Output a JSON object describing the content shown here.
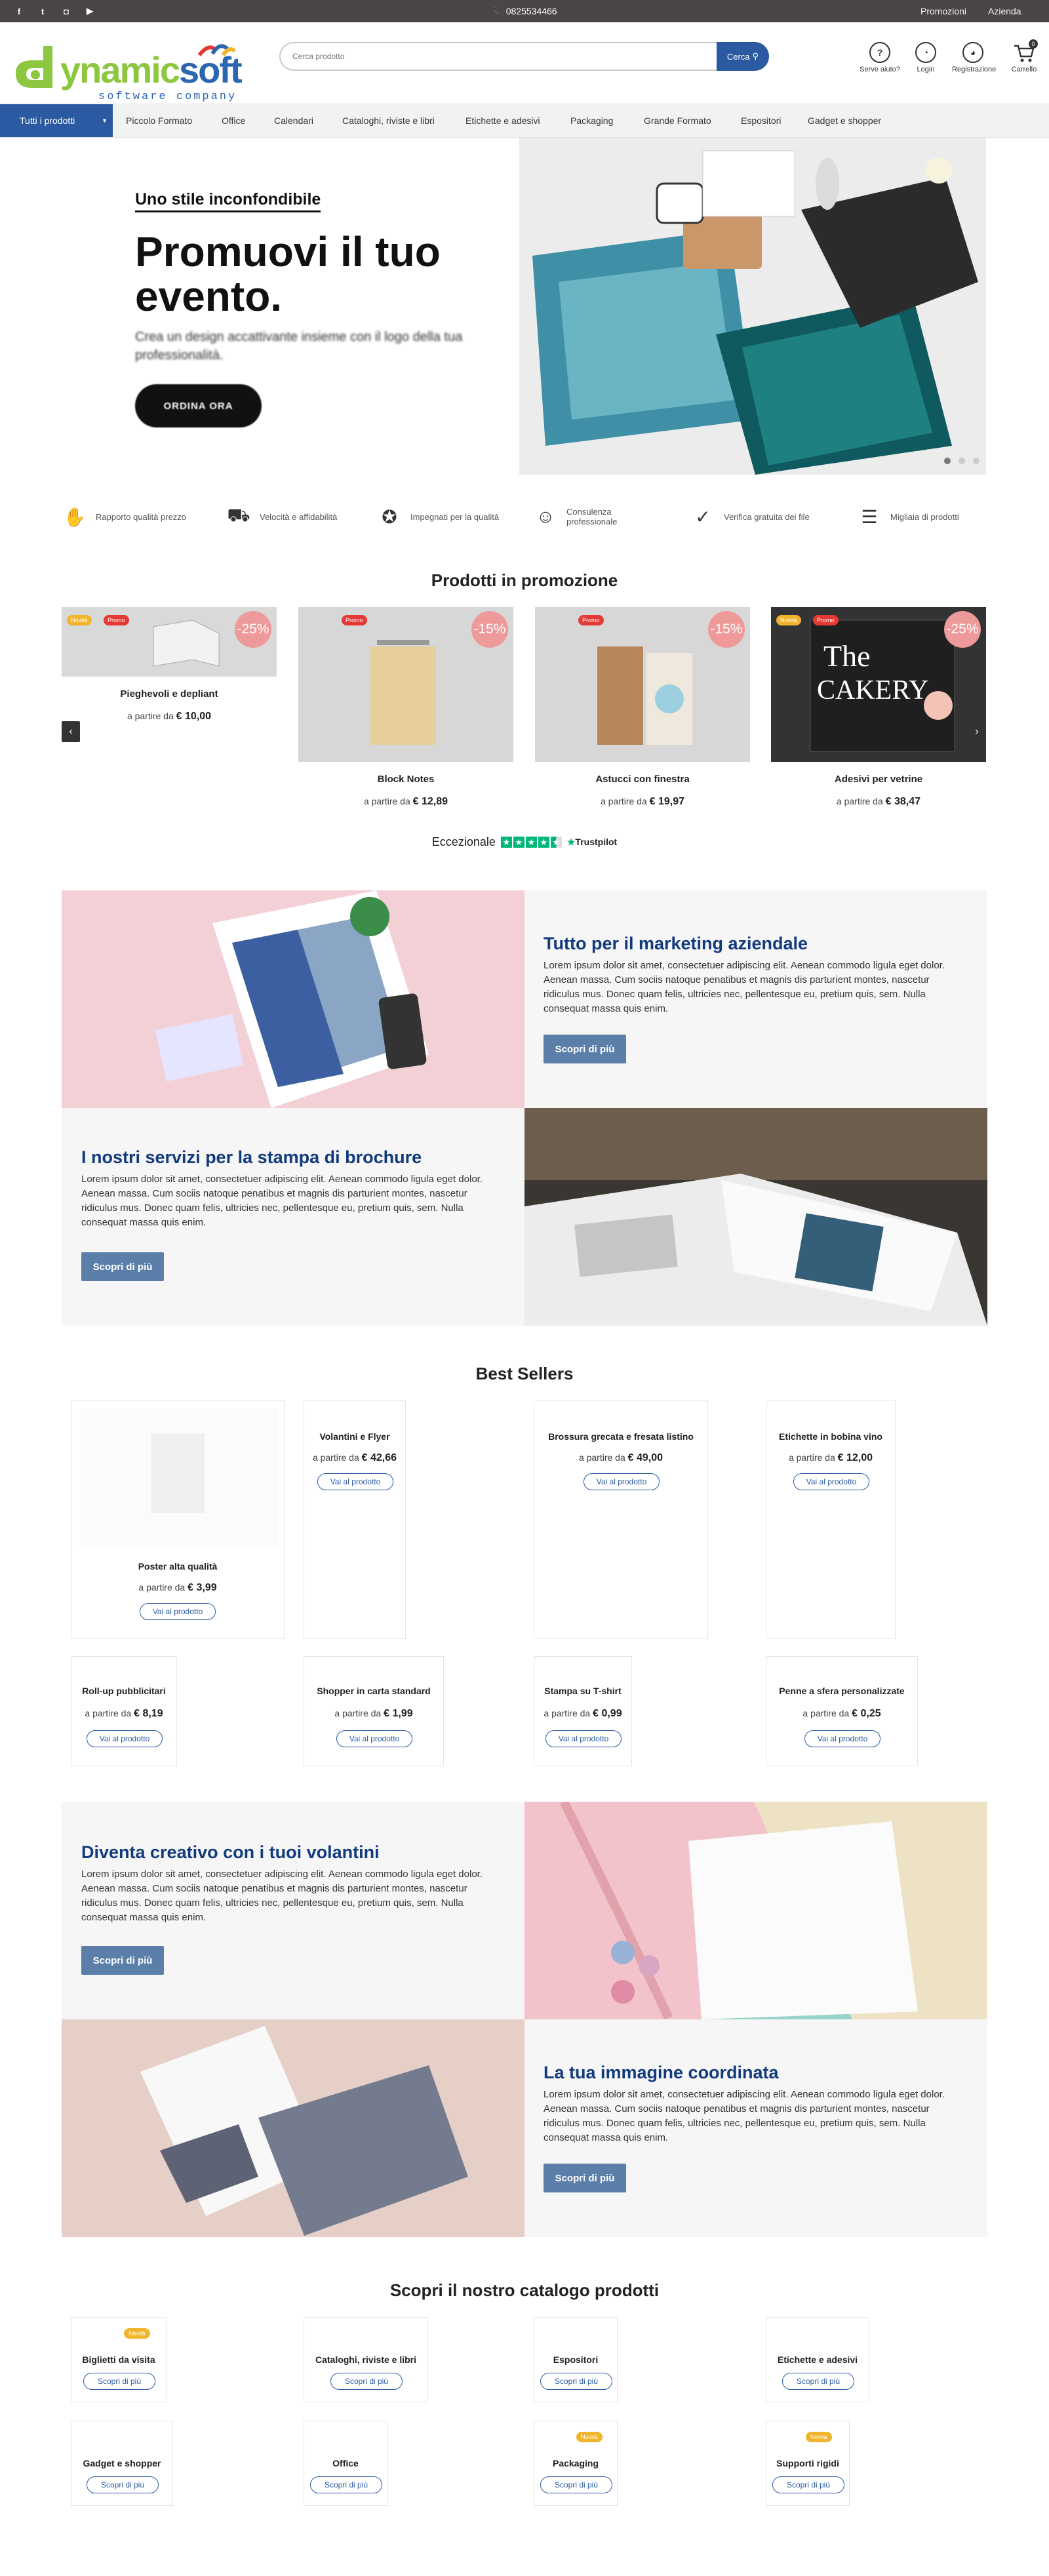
{
  "topbar": {
    "phone": "📞 0825534466",
    "links": [
      "Promozioni",
      "Azienda"
    ]
  },
  "header": {
    "logo_brand_a": "ynamic",
    "logo_brand_b": "soft",
    "logo_tagline": "software company",
    "search_placeholder": "Cerca prodotto",
    "search_button": "Cerca",
    "icons": [
      {
        "label": "Serve aiuto?",
        "icon": "help-icon"
      },
      {
        "label": "Login",
        "icon": "user-icon"
      },
      {
        "label": "Registrazione",
        "icon": "register-icon"
      },
      {
        "label": "Carrello",
        "icon": "cart-icon",
        "count": "0"
      }
    ]
  },
  "nav": {
    "all_label": "Tutti i prodotti",
    "items": [
      "Piccolo Formato",
      "Office",
      "Calendari",
      "Cataloghi, riviste e libri",
      "Etichette e adesivi",
      "Packaging",
      "Grande Formato",
      "Espositori",
      "Gadget e shopper"
    ]
  },
  "hero": {
    "kicker": "Uno stile inconfondibile",
    "title": "Promuovi il tuo evento.",
    "text": "Crea un design accattivante insieme con il logo della tua professionalità.",
    "button": "ORDINA ORA"
  },
  "features": [
    "Rapporto qualità prezzo",
    "Velocità e affidabilità",
    "Impegnati per la qualità",
    "Consulenza professionale",
    "Verifica gratuita dei file",
    "Migliaia di prodotti"
  ],
  "promo": {
    "title": "Prodotti in promozione",
    "products": [
      {
        "name": "Pieghevoli e depliant",
        "price_prefix": "a partire da",
        "price": "€ 10,00",
        "discount": "-25%",
        "badges": [
          "Novità",
          "Promo"
        ]
      },
      {
        "name": "Block Notes",
        "price_prefix": "a partire da",
        "price": "€ 12,89",
        "discount": "-15%",
        "badges": [
          "Promo"
        ]
      },
      {
        "name": "Astucci con finestra",
        "price_prefix": "a partire da",
        "price": "€ 19,97",
        "discount": "-15%",
        "badges": [
          "Promo"
        ]
      },
      {
        "name": "Adesivi per vetrine",
        "price_prefix": "a partire da",
        "price": "€ 38,47",
        "discount": "-25%",
        "badges": [
          "Novità",
          "Promo"
        ]
      }
    ]
  },
  "trustpilot": {
    "rating_text": "Eccezionale",
    "brand": "Trustpilot"
  },
  "blocks": [
    {
      "title": "Tutto per il marketing aziendale",
      "text": "Lorem ipsum dolor sit amet, consectetuer adipiscing elit. Aenean commodo ligula eget dolor. Aenean massa. Cum sociis natoque penatibus et magnis dis parturient montes, nascetur ridiculus mus. Donec quam felis, ultricies nec, pellentesque eu, pretium quis, sem. Nulla consequat massa quis enim.",
      "button": "Scopri di più"
    },
    {
      "title": "I nostri servizi per la stampa di brochure",
      "text": "Lorem ipsum dolor sit amet, consectetuer adipiscing elit. Aenean commodo ligula eget dolor. Aenean massa. Cum sociis natoque penatibus et magnis dis parturient montes, nascetur ridiculus mus. Donec quam felis, ultricies nec, pellentesque eu, pretium quis, sem. Nulla consequat massa quis enim.",
      "button": "Scopri di più"
    },
    {
      "title": "Diventa creativo con i tuoi volantini",
      "text": "Lorem ipsum dolor sit amet, consectetuer adipiscing elit. Aenean commodo ligula eget dolor. Aenean massa. Cum sociis natoque penatibus et magnis dis parturient montes, nascetur ridiculus mus. Donec quam felis, ultricies nec, pellentesque eu, pretium quis, sem. Nulla consequat massa quis enim.",
      "button": "Scopri di più"
    },
    {
      "title": "La tua immagine coordinata",
      "text": "Lorem ipsum dolor sit amet, consectetuer adipiscing elit. Aenean commodo ligula eget dolor. Aenean massa. Cum sociis natoque penatibus et magnis dis parturient montes, nascetur ridiculus mus. Donec quam felis, ultricies nec, pellentesque eu, pretium quis, sem. Nulla consequat massa quis enim.",
      "button": "Scopri di più"
    }
  ],
  "bestsellers": {
    "title": "Best Sellers",
    "button": "Vai al prodotto",
    "price_prefix": "a partire da",
    "items": [
      {
        "name": "Poster alta qualità",
        "price": "€ 3,99"
      },
      {
        "name": "Volantini e Flyer",
        "price": "€ 42,66"
      },
      {
        "name": "Brossura grecata e fresata listino",
        "price": "€ 49,00"
      },
      {
        "name": "Etichette in bobina vino",
        "price": "€ 12,00"
      },
      {
        "name": "Roll-up pubblicitari",
        "price": "€ 8,19"
      },
      {
        "name": "Shopper in carta standard",
        "price": "€ 1,99"
      },
      {
        "name": "Stampa su T-shirt",
        "price": "€ 0,99"
      },
      {
        "name": "Penne a sfera personalizzate",
        "price": "€ 0,25"
      }
    ]
  },
  "catalog": {
    "title": "Scopri il nostro catalogo prodotti",
    "button": "Scopri di più",
    "badge": "Novità",
    "items": [
      {
        "name": "Biglietti da visita",
        "badge": true
      },
      {
        "name": "Cataloghi, riviste e libri",
        "badge": false
      },
      {
        "name": "Espositori",
        "badge": false
      },
      {
        "name": "Etichette e adesivi",
        "badge": false
      },
      {
        "name": "Gadget e shopper",
        "badge": false
      },
      {
        "name": "Office",
        "badge": false
      },
      {
        "name": "Packaging",
        "badge": true
      },
      {
        "name": "Supporti rigidi",
        "badge": true
      }
    ]
  },
  "colors": {
    "primary": "#2b5aa3",
    "heading_blue": "#123b7d",
    "logo_green": "#8dc63f",
    "trust_green": "#00b67a",
    "button_steel": "#5b7fa8"
  }
}
